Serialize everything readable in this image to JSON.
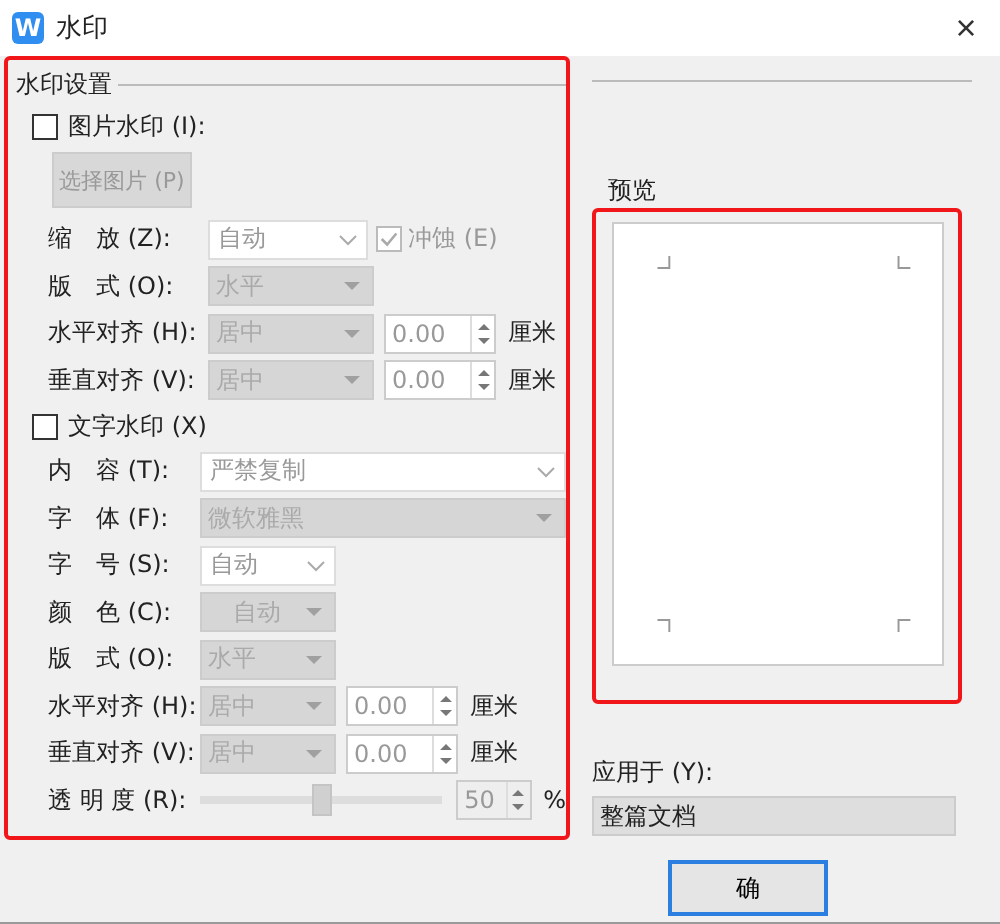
{
  "window": {
    "app_icon": "W",
    "title": "水印",
    "close": "×"
  },
  "settings": {
    "title": "水印设置",
    "picture_watermark": {
      "label": "图片水印 (I):",
      "checked": false,
      "button": "选择图片 (P)",
      "rows": [
        {
          "label": "缩　放 (Z):",
          "kind": "combo",
          "value": "自动",
          "check": {
            "label": "冲蚀 (E)",
            "checked": true
          }
        },
        {
          "label": "版　式 (O):",
          "kind": "select",
          "value": "水平"
        },
        {
          "label": "水平对齐 (H):",
          "kind": "select",
          "value": "居中",
          "spin": "0.00",
          "unit": "厘米"
        },
        {
          "label": "垂直对齐 (V):",
          "kind": "select",
          "value": "居中",
          "spin": "0.00",
          "unit": "厘米"
        }
      ]
    },
    "text_watermark": {
      "label": "文字水印 (X)",
      "checked": false,
      "rows": [
        {
          "label": "内　容 (T):",
          "kind": "combo",
          "value": "严禁复制"
        },
        {
          "label": "字　体 (F):",
          "kind": "select",
          "value": "微软雅黑"
        },
        {
          "label": "字　号 (S):",
          "kind": "combo",
          "value": "自动"
        },
        {
          "label": "颜　色 (C):",
          "kind": "select",
          "value": "自动"
        },
        {
          "label": "版　式 (O):",
          "kind": "select",
          "value": "水平"
        },
        {
          "label": "水平对齐 (H):",
          "kind": "select",
          "value": "居中",
          "spin": "0.00",
          "unit": "厘米"
        },
        {
          "label": "垂直对齐 (V):",
          "kind": "select",
          "value": "居中",
          "spin": "0.00",
          "unit": "厘米"
        },
        {
          "label": "透 明 度 (R):",
          "kind": "slider",
          "level": 0.5,
          "spin": "50",
          "unit": "%"
        }
      ]
    }
  },
  "preview": {
    "title": "预览"
  },
  "apply_to": {
    "label": "应用于 (Y):",
    "value": "整篇文档"
  },
  "ok_button": "确"
}
